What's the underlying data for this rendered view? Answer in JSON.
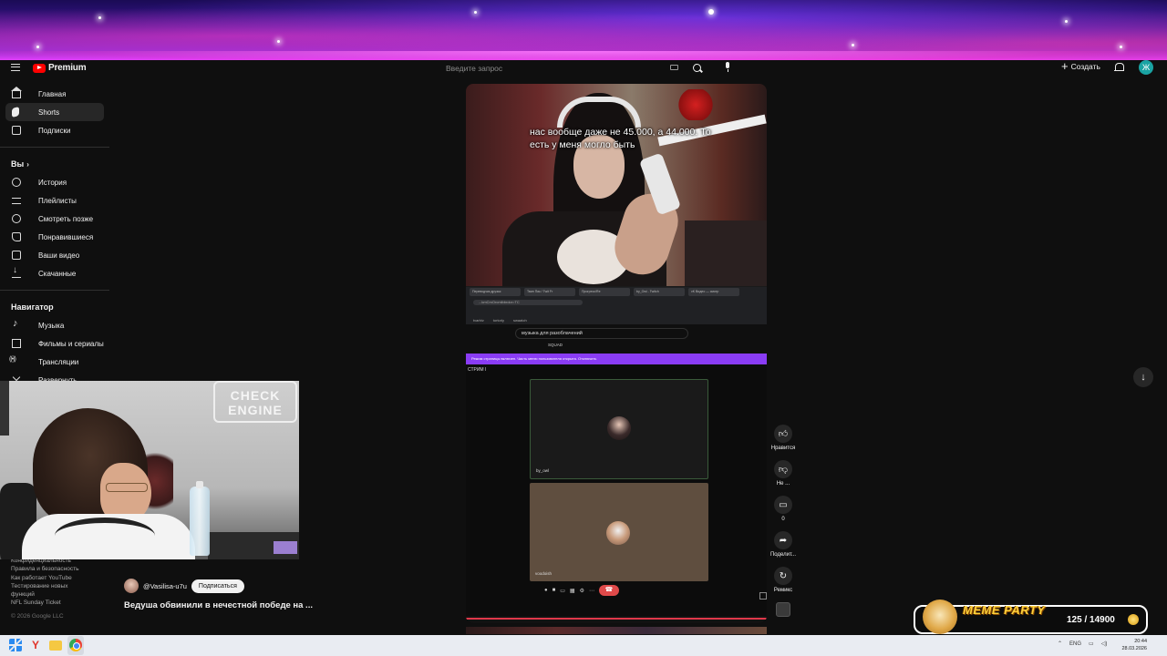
{
  "header": {
    "logo_text": "Premium",
    "search_placeholder": "Введите запрос",
    "create_label": "Создать",
    "avatar_letter": "Ж"
  },
  "sidebar": {
    "main": [
      {
        "label": "Главная",
        "icon": "home-icon"
      },
      {
        "label": "Shorts",
        "icon": "shorts-icon",
        "active": true
      },
      {
        "label": "Подписки",
        "icon": "subscriptions-icon"
      }
    ],
    "you_title": "Вы",
    "you": [
      {
        "label": "История",
        "icon": "history-icon"
      },
      {
        "label": "Плейлисты",
        "icon": "playlists-icon"
      },
      {
        "label": "Смотреть позже",
        "icon": "watch-later-icon"
      },
      {
        "label": "Понравившиеся",
        "icon": "liked-icon"
      },
      {
        "label": "Ваши видео",
        "icon": "your-videos-icon"
      },
      {
        "label": "Скачанные",
        "icon": "downloads-icon"
      }
    ],
    "nav_title": "Навигатор",
    "nav": [
      {
        "label": "Музыка",
        "icon": "music-icon"
      },
      {
        "label": "Фильмы и сериалы",
        "icon": "movies-icon"
      },
      {
        "label": "Трансляции",
        "icon": "live-icon"
      },
      {
        "label": "Развернуть",
        "icon": "expand-icon"
      }
    ],
    "footer_links": [
      "Конфиденциальность",
      "Правила и безопасность",
      "Как работает YouTube",
      "Тестирование новых",
      "функций",
      "NFL Sunday Ticket"
    ],
    "copyright": "© 2026 Google LLC"
  },
  "webcam": {
    "sign_text": "CHECK ENGINE"
  },
  "short": {
    "caption": "нас вообще даже не 45.000, а 44.000. То есть у меня могло быть",
    "channel": "@Vasilisa-u7u",
    "subscribe_label": "Подписаться",
    "title": "Ведуша обвинили в нечестной победе на ..."
  },
  "inner_screen": {
    "tabs": [
      "Переводчик друзья",
      "Твин Пик / Twit Fr",
      "Прогресс/Re",
      "by_Owl - Twitch",
      "vK Видео — смотр"
    ],
    "address": "...kmCmOrcmlbbrdor=TC",
    "bookmarks": [
      "tvarbiv",
      "tortorly",
      "swaatch"
    ],
    "search_text": "музыка для разоблачений",
    "tag": "SQUAD",
    "banner": "Режим страницы включен. Часть меню пользователя открыта.  Отключить",
    "call_label": "СТРИМ I",
    "participant1": "by_owl",
    "participant2": "voodoish"
  },
  "actions": {
    "like_label": "Нравится",
    "dislike_label": "Не ...",
    "comments_count": "0",
    "share_label": "Поделит...",
    "remix_label": "Ремикс"
  },
  "overlay": {
    "meme_title": "MEME PARTY",
    "meme_progress": "125 / 14900"
  },
  "taskbar": {
    "lang": "ENG",
    "time": "20:44",
    "date": "28.03.2026"
  }
}
